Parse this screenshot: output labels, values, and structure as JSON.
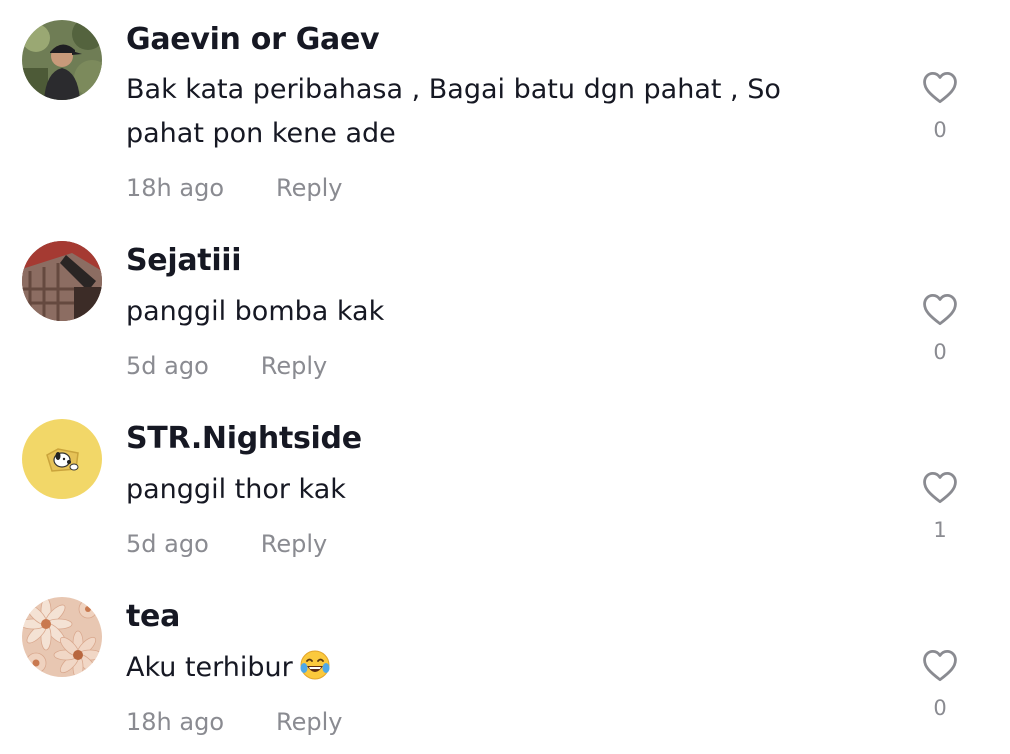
{
  "comments": [
    {
      "username": "Gaevin or Gaev",
      "text": "Bak kata peribahasa , Bagai batu dgn pahat , So pahat pon kene ade",
      "time": "18h ago",
      "reply_label": "Reply",
      "likes": "0",
      "avatar_icon": "person-outdoors-avatar"
    },
    {
      "username": "Sejatiii",
      "text": "panggil bomba kak",
      "time": "5d ago",
      "reply_label": "Reply",
      "likes": "0",
      "avatar_icon": "plaid-shirt-avatar"
    },
    {
      "username": "STR.Nightside",
      "text": "panggil thor kak",
      "time": "5d ago",
      "reply_label": "Reply",
      "likes": "1",
      "avatar_icon": "cartoon-dog-avatar"
    },
    {
      "username": "tea",
      "text": "Aku terhibur",
      "emoji": "😂",
      "time": "18h ago",
      "reply_label": "Reply",
      "likes": "0",
      "avatar_icon": "flower-avatar"
    }
  ],
  "colors": {
    "text": "#161823",
    "secondary": "#8a8b91",
    "background": "#ffffff"
  }
}
